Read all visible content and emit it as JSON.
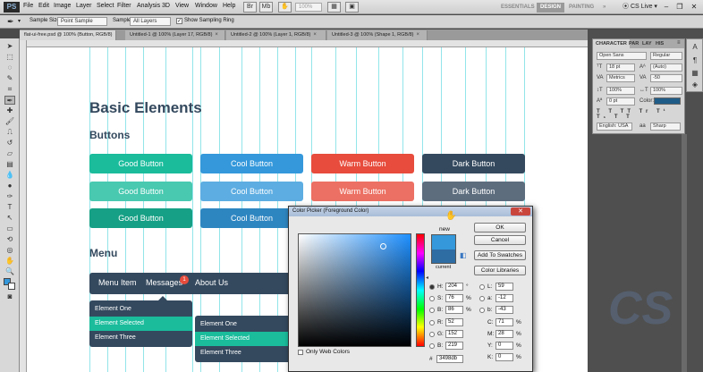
{
  "app": {
    "logo": "PS"
  },
  "menubar": {
    "items": [
      "File",
      "Edit",
      "Image",
      "Layer",
      "Select",
      "Filter",
      "Analysis",
      "3D",
      "View",
      "Window",
      "Help"
    ],
    "zoom": "100%",
    "workspaces": [
      "ESSENTIALS",
      "DESIGN",
      "PAINTING"
    ],
    "active_workspace": "DESIGN",
    "cs_live": "CS Live"
  },
  "optbar": {
    "sample_size_label": "Sample Size:",
    "sample_size_value": "Point Sample",
    "sample_label": "Sample:",
    "sample_value": "All Layers",
    "show_ring_label": "Show Sampling Ring"
  },
  "doctabs": [
    {
      "label": "flat-ui-free.psd @ 100% (Button, RGB/8)"
    },
    {
      "label": "Untitled-1 @ 100% (Layer 17, RGB/8)"
    },
    {
      "label": "Untitled-2 @ 100% (Layer 1, RGB/8)"
    },
    {
      "label": "Untitled-3 @ 100% (Shape 1, RGB/8)"
    }
  ],
  "canvas": {
    "title": "Basic Elements",
    "buttons_heading": "Buttons",
    "menu_heading": "Menu",
    "buttons": [
      [
        {
          "label": "Good Button",
          "color": "#1abc9c"
        },
        {
          "label": "Cool Button",
          "color": "#3498db"
        },
        {
          "label": "Warm Button",
          "color": "#e74c3c"
        },
        {
          "label": "Dark Button",
          "color": "#34495e"
        }
      ],
      [
        {
          "label": "Good Button",
          "color": "#48c9b0"
        },
        {
          "label": "Cool Button",
          "color": "#5dade2"
        },
        {
          "label": "Warm Button",
          "color": "#ec7063"
        },
        {
          "label": "Dark Button",
          "color": "#5d6d7e"
        }
      ],
      [
        {
          "label": "Good Button",
          "color": "#16a085"
        },
        {
          "label": "Cool Button",
          "color": "#2e86c1"
        }
      ]
    ],
    "nav": {
      "items": [
        "Menu Item",
        "Messages",
        "About Us"
      ],
      "badge": "1"
    },
    "dropdown1": [
      "Element One",
      "Element Selected",
      "Element Three"
    ],
    "dropdown2": [
      "Element One",
      "Element Selected",
      "Element Three"
    ]
  },
  "character_panel": {
    "tabs": [
      "CHARACTER",
      "PAR",
      "LAY",
      "HIS"
    ],
    "font_family": "Open Sans",
    "font_style": "Regular",
    "size": "18 pt",
    "leading": "(Auto)",
    "kerning": "Metrics",
    "tracking": "-50",
    "vscale": "100%",
    "hscale": "100%",
    "baseline": "0 pt",
    "color_label": "Color:",
    "language": "English: USA",
    "aa_label": "aa",
    "antialias": "Sharp"
  },
  "color_picker": {
    "title": "Color Picker (Foreground Color)",
    "new_label": "new",
    "current_label": "current",
    "buttons": {
      "ok": "OK",
      "cancel": "Cancel",
      "add_swatches": "Add To Swatches",
      "libraries": "Color Libraries"
    },
    "only_web_colors": "Only Web Colors",
    "hsb": [
      {
        "label": "H:",
        "value": "204",
        "unit": "°"
      },
      {
        "label": "S:",
        "value": "76",
        "unit": "%"
      },
      {
        "label": "B:",
        "value": "86",
        "unit": "%"
      }
    ],
    "rgb": [
      {
        "label": "R:",
        "value": "52"
      },
      {
        "label": "G:",
        "value": "152"
      },
      {
        "label": "B:",
        "value": "219"
      }
    ],
    "lab": [
      {
        "label": "L:",
        "value": "59"
      },
      {
        "label": "a:",
        "value": "-12"
      },
      {
        "label": "b:",
        "value": "-43"
      }
    ],
    "cmyk": [
      {
        "label": "C:",
        "value": "71",
        "unit": "%"
      },
      {
        "label": "M:",
        "value": "28",
        "unit": "%"
      },
      {
        "label": "Y:",
        "value": "0",
        "unit": "%"
      },
      {
        "label": "K:",
        "value": "0",
        "unit": "%"
      }
    ],
    "hex_label": "#",
    "hex": "3498db",
    "new_color": "#3498db",
    "current_color": "#2e6da4"
  },
  "watermark": "CS"
}
